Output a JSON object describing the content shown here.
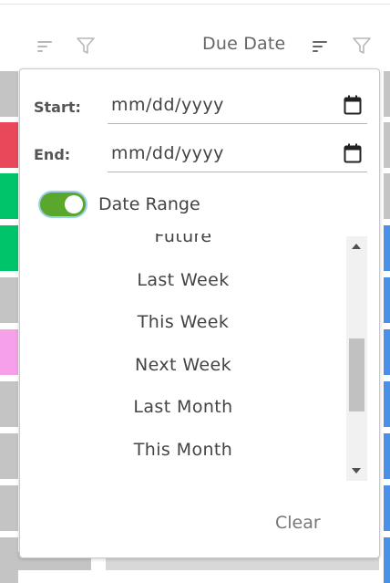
{
  "header": {
    "due_date_label": "Due Date"
  },
  "colors": {
    "accent_green": "#59a82d",
    "row_red": "#e8485a",
    "row_green": "#00c46a",
    "row_pink": "#f5a0e9",
    "row_grey": "#c4c4c4",
    "row_blue": "#4a90e8"
  },
  "filter_popover": {
    "start_label": "Start:",
    "start_placeholder": "mm/dd/yyyy",
    "end_label": "End:",
    "end_placeholder": "mm/dd/yyyy",
    "date_range_label": "Date Range",
    "date_range_enabled": true,
    "options": [
      "Future",
      "Last Week",
      "This Week",
      "Next Week",
      "Last Month",
      "This Month"
    ],
    "clear_label": "Clear"
  }
}
